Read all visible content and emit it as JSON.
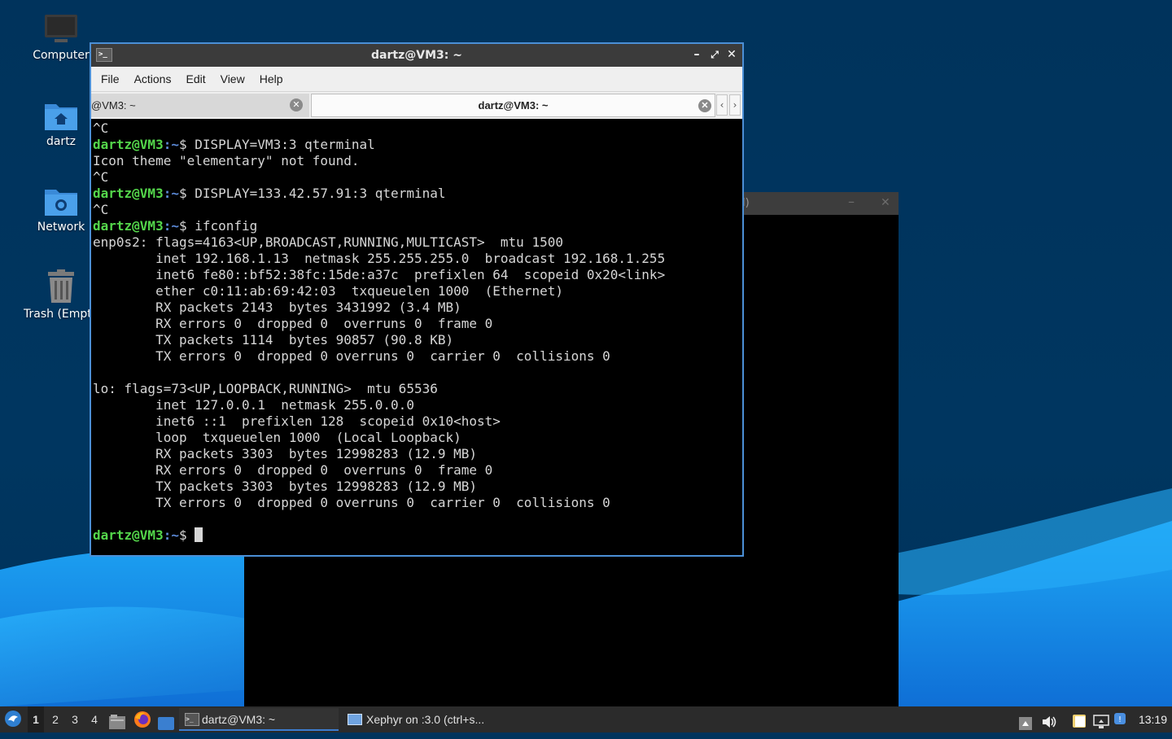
{
  "desktop": {
    "icons": [
      {
        "label": "Computer"
      },
      {
        "label": "dartz"
      },
      {
        "label": "Network"
      },
      {
        "label": "Trash (Empty)"
      }
    ]
  },
  "xephyr_window": {
    "title_fragment": "l)"
  },
  "terminal": {
    "title": "dartz@VM3: ~",
    "menu": [
      "File",
      "Actions",
      "Edit",
      "View",
      "Help"
    ],
    "tabs": [
      {
        "label": "@VM3: ~"
      },
      {
        "label": "dartz@VM3: ~"
      }
    ],
    "prompt_user": "dartz@VM3",
    "prompt_path": ":~",
    "prompt_suffix": "$ ",
    "lines": [
      {
        "type": "out",
        "text": "^C"
      },
      {
        "type": "cmd",
        "text": "DISPLAY=VM3:3 qterminal"
      },
      {
        "type": "out",
        "text": "Icon theme \"elementary\" not found."
      },
      {
        "type": "out",
        "text": "^C"
      },
      {
        "type": "cmd",
        "text": "DISPLAY=133.42.57.91:3 qterminal"
      },
      {
        "type": "out",
        "text": "^C"
      },
      {
        "type": "cmd",
        "text": "ifconfig"
      },
      {
        "type": "out",
        "text": "enp0s2: flags=4163<UP,BROADCAST,RUNNING,MULTICAST>  mtu 1500"
      },
      {
        "type": "out",
        "text": "        inet 192.168.1.13  netmask 255.255.255.0  broadcast 192.168.1.255"
      },
      {
        "type": "out",
        "text": "        inet6 fe80::bf52:38fc:15de:a37c  prefixlen 64  scopeid 0x20<link>"
      },
      {
        "type": "out",
        "text": "        ether c0:11:ab:69:42:03  txqueuelen 1000  (Ethernet)"
      },
      {
        "type": "out",
        "text": "        RX packets 2143  bytes 3431992 (3.4 MB)"
      },
      {
        "type": "out",
        "text": "        RX errors 0  dropped 0  overruns 0  frame 0"
      },
      {
        "type": "out",
        "text": "        TX packets 1114  bytes 90857 (90.8 KB)"
      },
      {
        "type": "out",
        "text": "        TX errors 0  dropped 0 overruns 0  carrier 0  collisions 0"
      },
      {
        "type": "out",
        "text": ""
      },
      {
        "type": "out",
        "text": "lo: flags=73<UP,LOOPBACK,RUNNING>  mtu 65536"
      },
      {
        "type": "out",
        "text": "        inet 127.0.0.1  netmask 255.0.0.0"
      },
      {
        "type": "out",
        "text": "        inet6 ::1  prefixlen 128  scopeid 0x10<host>"
      },
      {
        "type": "out",
        "text": "        loop  txqueuelen 1000  (Local Loopback)"
      },
      {
        "type": "out",
        "text": "        RX packets 3303  bytes 12998283 (12.9 MB)"
      },
      {
        "type": "out",
        "text": "        RX errors 0  dropped 0  overruns 0  frame 0"
      },
      {
        "type": "out",
        "text": "        TX packets 3303  bytes 12998283 (12.9 MB)"
      },
      {
        "type": "out",
        "text": "        TX errors 0  dropped 0 overruns 0  carrier 0  collisions 0"
      },
      {
        "type": "out",
        "text": ""
      },
      {
        "type": "cmd",
        "text": "",
        "cursor": true
      }
    ]
  },
  "taskbar": {
    "workspaces": [
      "1",
      "2",
      "3",
      "4"
    ],
    "active_workspace": "1",
    "tasks": [
      {
        "label": "dartz@VM3: ~",
        "active": true
      },
      {
        "label": "Xephyr on :3.0 (ctrl+s..."
      }
    ],
    "clock": "13:19"
  },
  "colors": {
    "prompt_user": "#54d64b",
    "prompt_dir": "#5c8ad8",
    "window_border": "#4b8fd6",
    "wallpaper": "#00335c"
  }
}
